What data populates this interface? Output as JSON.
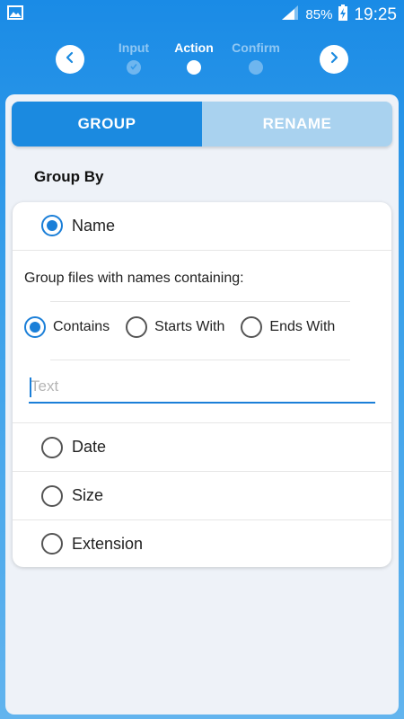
{
  "status_bar": {
    "battery_percent": "85%",
    "time": "19:25",
    "icons": [
      "image-icon",
      "signal-icon",
      "battery-charging-icon"
    ]
  },
  "stepper": {
    "steps": [
      {
        "label": "Input",
        "state": "done"
      },
      {
        "label": "Action",
        "state": "active"
      },
      {
        "label": "Confirm",
        "state": "pending"
      }
    ],
    "prev_icon": "chevron-left-icon",
    "next_icon": "chevron-right-icon"
  },
  "tabs": [
    {
      "label": "GROUP",
      "active": true
    },
    {
      "label": "RENAME",
      "active": false
    }
  ],
  "group_by": {
    "title": "Group By",
    "options": [
      {
        "label": "Name",
        "selected": true
      },
      {
        "label": "Date",
        "selected": false
      },
      {
        "label": "Size",
        "selected": false
      },
      {
        "label": "Extension",
        "selected": false
      }
    ],
    "name_panel": {
      "hint": "Group files with names containing:",
      "match_options": [
        {
          "label": "Contains",
          "selected": true
        },
        {
          "label": "Starts With",
          "selected": false
        },
        {
          "label": "Ends With",
          "selected": false
        }
      ],
      "text_field": {
        "value": "",
        "placeholder": "Text"
      }
    }
  },
  "colors": {
    "accent": "#1b7fd8",
    "tab_active": "#1b8ae0",
    "tab_inactive": "#a9d2ef",
    "background_top": "#1a8be6"
  }
}
